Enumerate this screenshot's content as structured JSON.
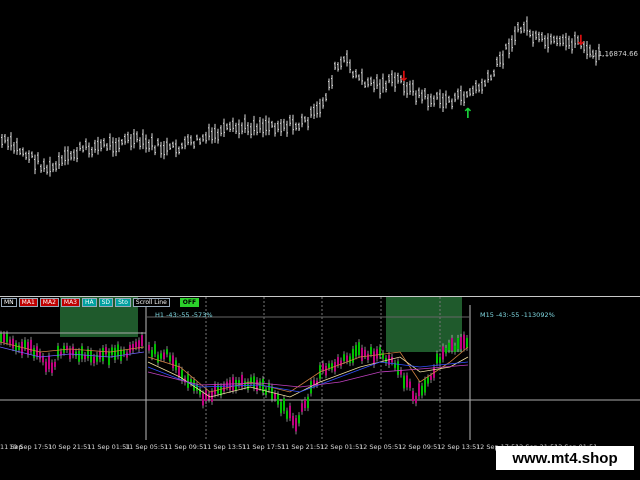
{
  "main": {
    "price_label": "1.16874.66"
  },
  "toolbar": {
    "buttons": [
      {
        "label": "MN",
        "style": "normal"
      },
      {
        "label": "MA1",
        "style": "red"
      },
      {
        "label": "MA2",
        "style": "red"
      },
      {
        "label": "MA3",
        "style": "red"
      },
      {
        "label": "HA",
        "style": "teal"
      },
      {
        "label": "SD",
        "style": "teal"
      },
      {
        "label": "Sto",
        "style": "teal"
      },
      {
        "label": "Scroll Line",
        "style": "normal"
      }
    ],
    "toggle_label": "OFF"
  },
  "indicator": {
    "h1_label": "H1   -43:-55   -573%",
    "m15_label": "M15   -43:-55   -113092%"
  },
  "time_axis": [
    "11 Sep",
    "10 Sep 17:51",
    "10 Sep 21:51",
    "11 Sep 01:51",
    "11 Sep 05:51",
    "11 Sep 09:51",
    "11 Sep 13:51",
    "11 Sep 17:51",
    "11 Sep 21:51",
    "12 Sep 01:51",
    "12 Sep 05:51",
    "12 Sep 09:51",
    "12 Sep 13:51",
    "12 Sep 17:51",
    "12 Sep 21:51",
    "13 Sep 01:51"
  ],
  "watermark": "www.mt4.shop",
  "colors": {
    "background": "#000000",
    "candle": "#dcdcdc",
    "arrow_down": "#e01010",
    "arrow_up": "#19d43a",
    "zone": "#1f5a2c",
    "bull": "#00c000",
    "bear": "#c00080"
  },
  "icons": {
    "arrow_down": "red-down-arrow-icon",
    "arrow_up": "green-up-arrow-icon"
  }
}
